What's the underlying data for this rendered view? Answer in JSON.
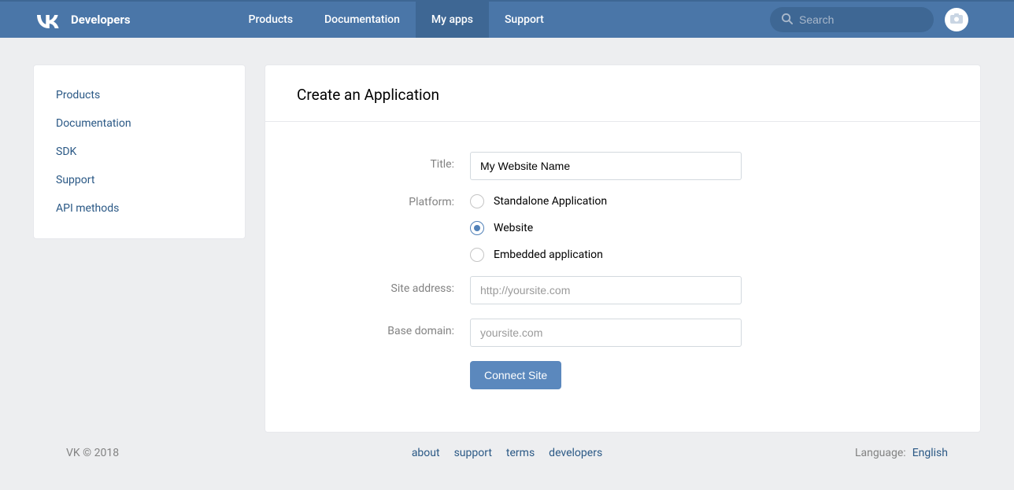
{
  "header": {
    "brand": "Developers",
    "nav": [
      {
        "label": "Products",
        "active": false
      },
      {
        "label": "Documentation",
        "active": false
      },
      {
        "label": "My apps",
        "active": true
      },
      {
        "label": "Support",
        "active": false
      }
    ],
    "search_placeholder": "Search"
  },
  "sidebar": {
    "items": [
      {
        "label": "Products"
      },
      {
        "label": "Documentation"
      },
      {
        "label": "SDK"
      },
      {
        "label": "Support"
      },
      {
        "label": "API methods"
      }
    ]
  },
  "main": {
    "title": "Create an Application",
    "form": {
      "title_label": "Title:",
      "title_value": "My Website Name",
      "platform_label": "Platform:",
      "platforms": [
        {
          "label": "Standalone Application",
          "checked": false
        },
        {
          "label": "Website",
          "checked": true
        },
        {
          "label": "Embedded application",
          "checked": false
        }
      ],
      "site_label": "Site address:",
      "site_value": "",
      "site_placeholder": "http://yoursite.com",
      "domain_label": "Base domain:",
      "domain_value": "",
      "domain_placeholder": "yoursite.com",
      "submit_label": "Connect Site"
    }
  },
  "footer": {
    "copyright": "VK © 2018",
    "links": [
      {
        "label": "about"
      },
      {
        "label": "support"
      },
      {
        "label": "terms"
      },
      {
        "label": "developers"
      }
    ],
    "language_label": "Language:",
    "language_value": "English"
  }
}
